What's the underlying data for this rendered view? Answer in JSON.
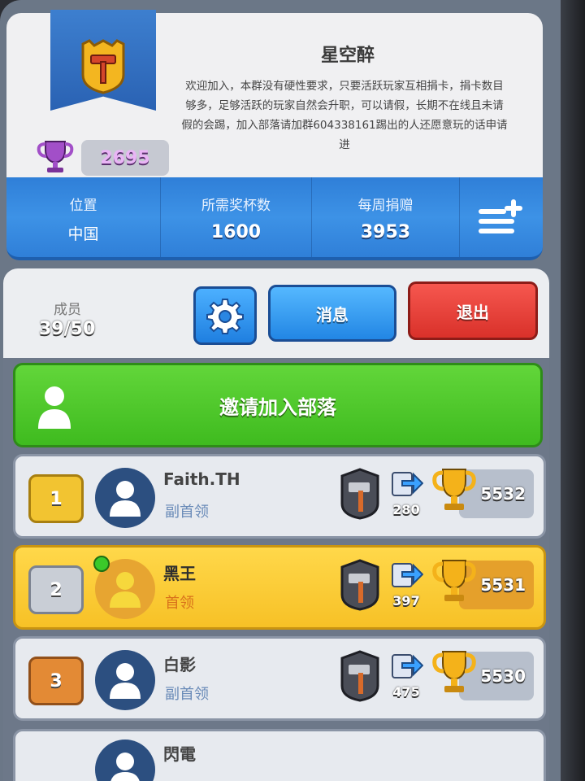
{
  "clan": {
    "name": "星空醉",
    "description": "欢迎加入，本群没有硬性要求，只要活跃玩家互相捐卡，捐卡数目够多，足够活跃的玩家自然会升职，可以请假，长期不在线且未请假的会踢，加入部落请加群604338161踢出的人还愿意玩的话申请进",
    "trophies": "2695",
    "badge_icon": "clan-badge-hammer-icon"
  },
  "stats": {
    "location_label": "位置",
    "location_value": "中国",
    "required_label": "所需奖杯数",
    "required_value": "1600",
    "donations_label": "每周捐赠",
    "donations_value": "3953"
  },
  "members": {
    "label": "成员",
    "count": "39/50"
  },
  "buttons": {
    "message": "消息",
    "leave": "退出",
    "invite": "邀请加入部落"
  },
  "member_list": [
    {
      "rank": "1",
      "name": "Faith.TH",
      "role": "副首领",
      "donations": "280",
      "trophies": "5532",
      "leader": false,
      "online": false
    },
    {
      "rank": "2",
      "name": "黑王",
      "role": "首领",
      "donations": "397",
      "trophies": "5531",
      "leader": true,
      "online": true
    },
    {
      "rank": "3",
      "name": "白影",
      "role": "副首领",
      "donations": "475",
      "trophies": "5530",
      "leader": false,
      "online": false
    },
    {
      "rank": "",
      "name": "閃電",
      "role": "",
      "donations": "",
      "trophies": "",
      "leader": false,
      "online": false
    }
  ],
  "colors": {
    "stats_bar": "#2f7fd8",
    "invite_green": "#3fbb1f",
    "leave_red": "#d9312a",
    "leader_row": "#f7c126"
  }
}
